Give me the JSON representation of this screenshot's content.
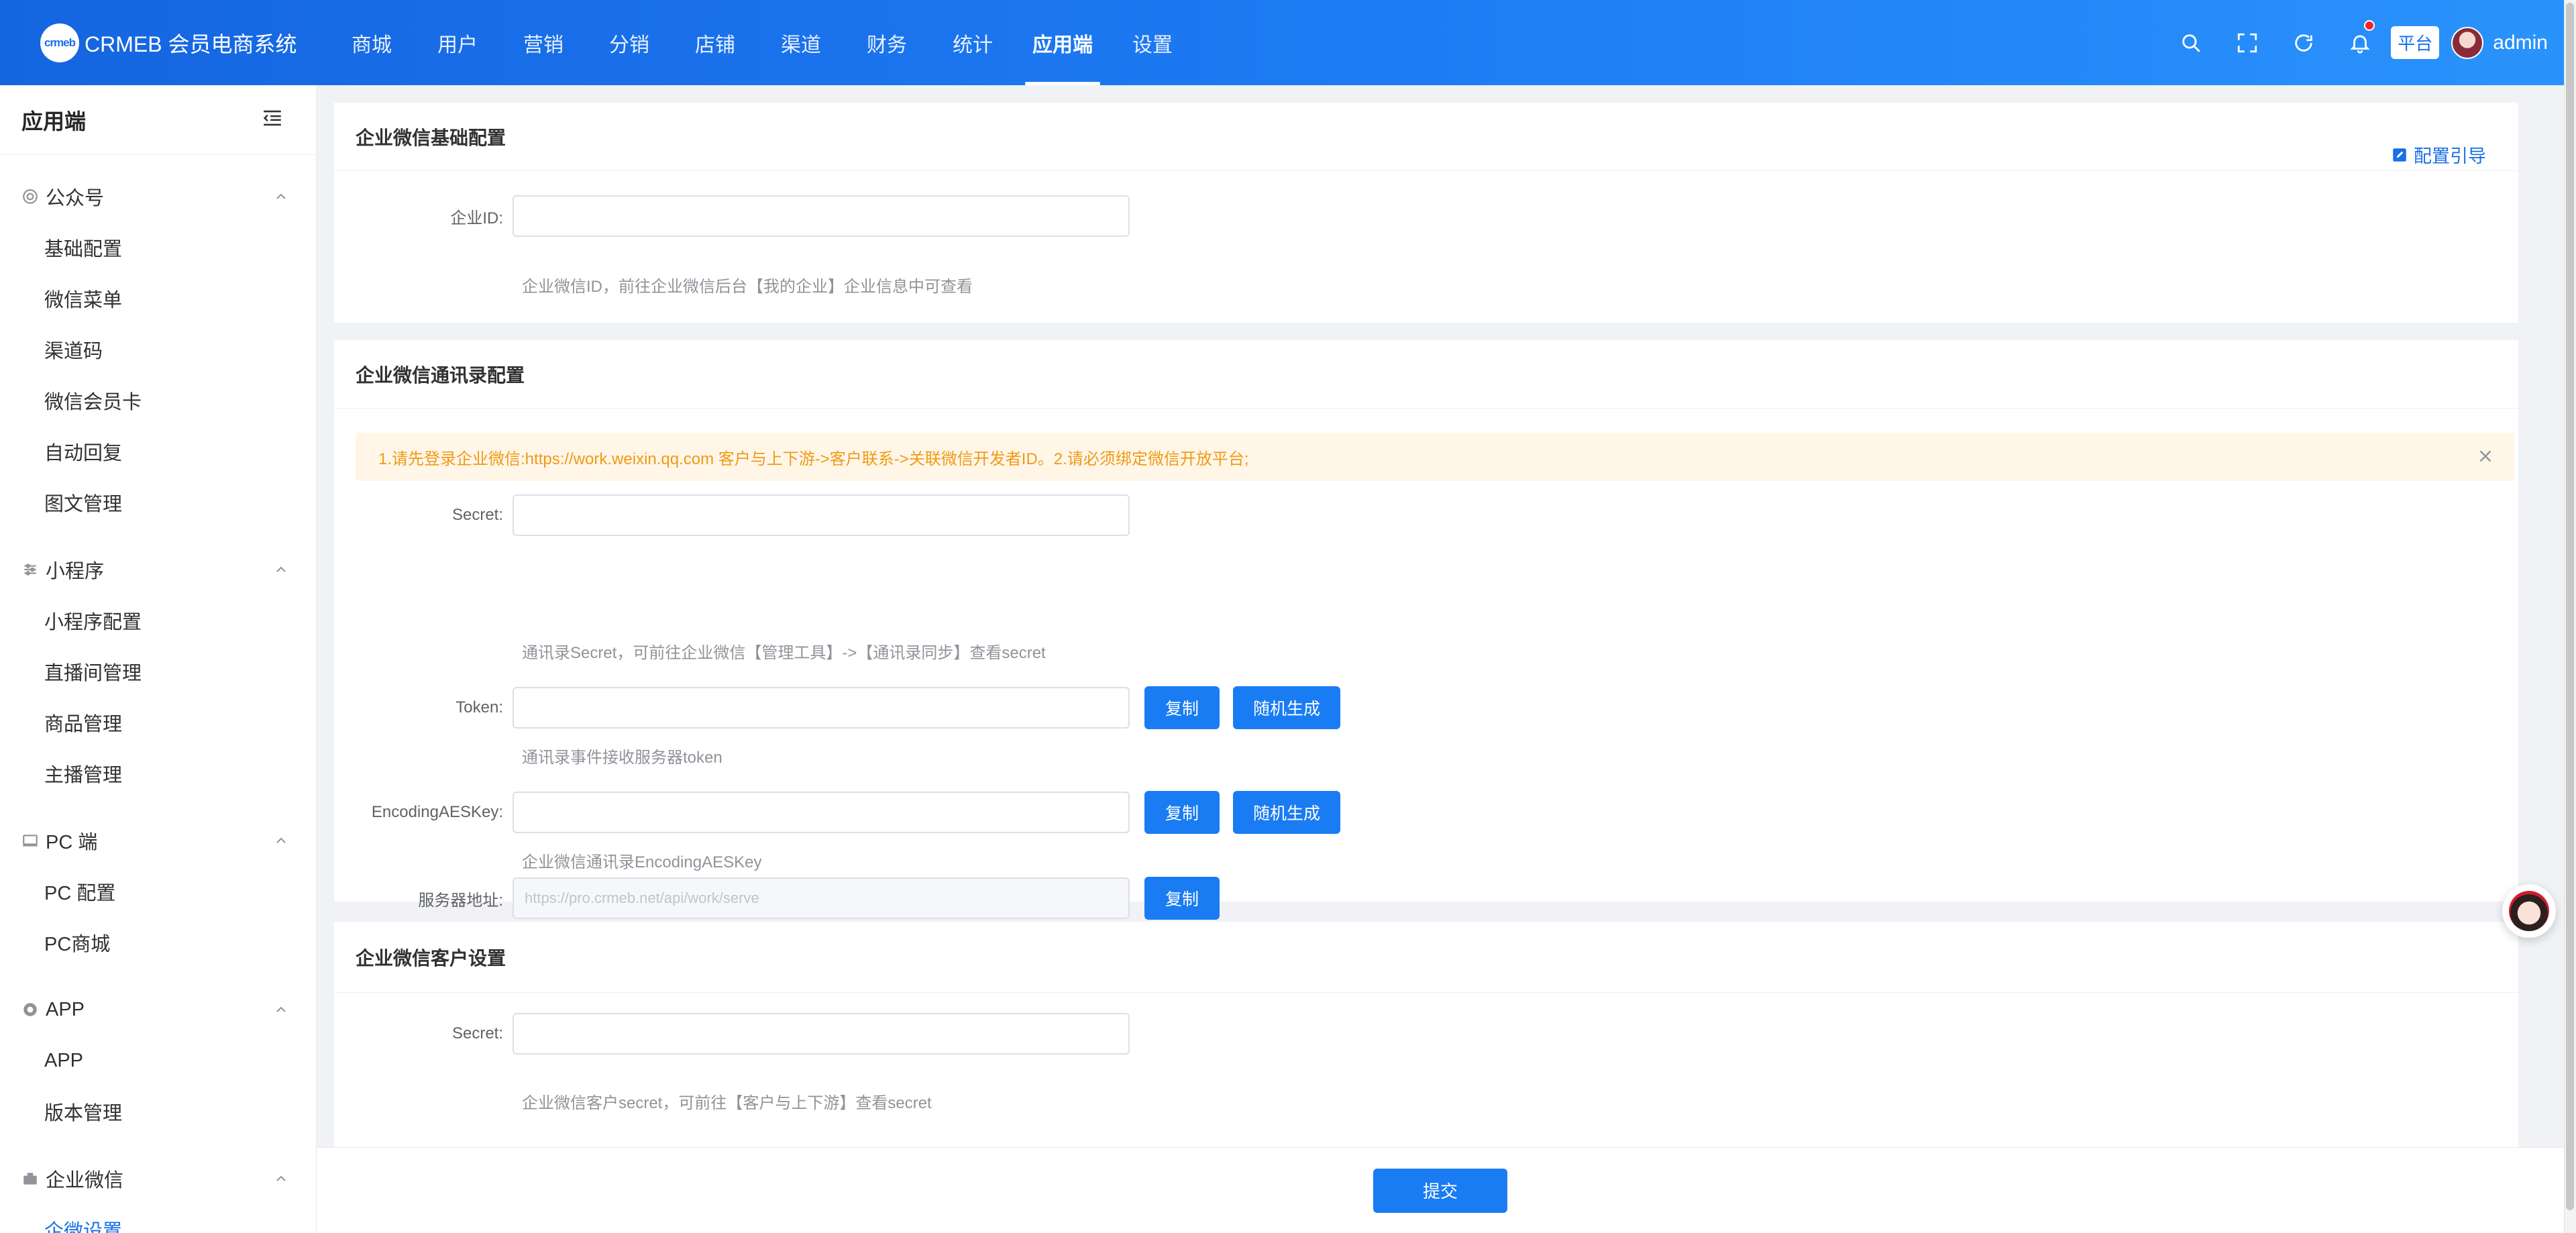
{
  "header": {
    "logo_mark": "crmeb",
    "logo_title": "CRMEB 会员电商系统",
    "nav": [
      "商城",
      "用户",
      "营销",
      "分销",
      "店铺",
      "渠道",
      "财务",
      "统计",
      "应用端",
      "设置"
    ],
    "active_nav": "应用端",
    "platform": "平台",
    "username": "admin"
  },
  "sidebar": {
    "title": "应用端",
    "groups": [
      {
        "label": "公众号",
        "icon": "wechat-icon",
        "items": [
          "基础配置",
          "微信菜单",
          "渠道码",
          "微信会员卡",
          "自动回复",
          "图文管理"
        ]
      },
      {
        "label": "小程序",
        "icon": "mini-program-icon",
        "items": [
          "小程序配置",
          "直播间管理",
          "商品管理",
          "主播管理"
        ]
      },
      {
        "label": "PC 端",
        "icon": "pc-icon",
        "items": [
          "PC 配置",
          "PC商城"
        ]
      },
      {
        "label": "APP",
        "icon": "app-icon",
        "items": [
          "APP",
          "版本管理"
        ]
      },
      {
        "label": "企业微信",
        "icon": "enterprise-icon",
        "items": [
          "企微设置"
        ]
      }
    ],
    "active_item": "企微设置"
  },
  "basic": {
    "title": "企业微信基础配置",
    "guide": "配置引导",
    "corp_id_label": "企业ID:",
    "corp_id_value": "",
    "corp_id_hint": "企业微信ID，前往企业微信后台【我的企业】企业信息中可查看"
  },
  "contacts": {
    "title": "企业微信通讯录配置",
    "alert": "1.请先登录企业微信:https://work.weixin.qq.com 客户与上下游->客户联系->关联微信开发者ID。2.请必须绑定微信开放平台;",
    "secret_label": "Secret:",
    "secret_value": "",
    "secret_hint": "通讯录Secret，可前往企业微信【管理工具】->【通讯录同步】查看secret",
    "token_label": "Token:",
    "token_value": "",
    "token_hint": "通讯录事件接收服务器token",
    "aes_label": "EncodingAESKey:",
    "aes_value": "",
    "aes_hint": "企业微信通讯录EncodingAESKey",
    "server_label": "服务器地址:",
    "server_value": "https://pro.crmeb.net/api/work/serve",
    "copy": "复制",
    "generate": "随机生成"
  },
  "customer": {
    "title": "企业微信客户设置",
    "secret_label": "Secret:",
    "secret_value": "",
    "secret_hint": "企业微信客户secret，可前往【客户与上下游】查看secret"
  },
  "footer": {
    "submit": "提交"
  },
  "colors": {
    "primary": "#1a7cf2",
    "header_start": "#1565e0",
    "header_end": "#2a93fb",
    "alert_bg": "#fff6e8",
    "alert_text": "#f09a14"
  }
}
